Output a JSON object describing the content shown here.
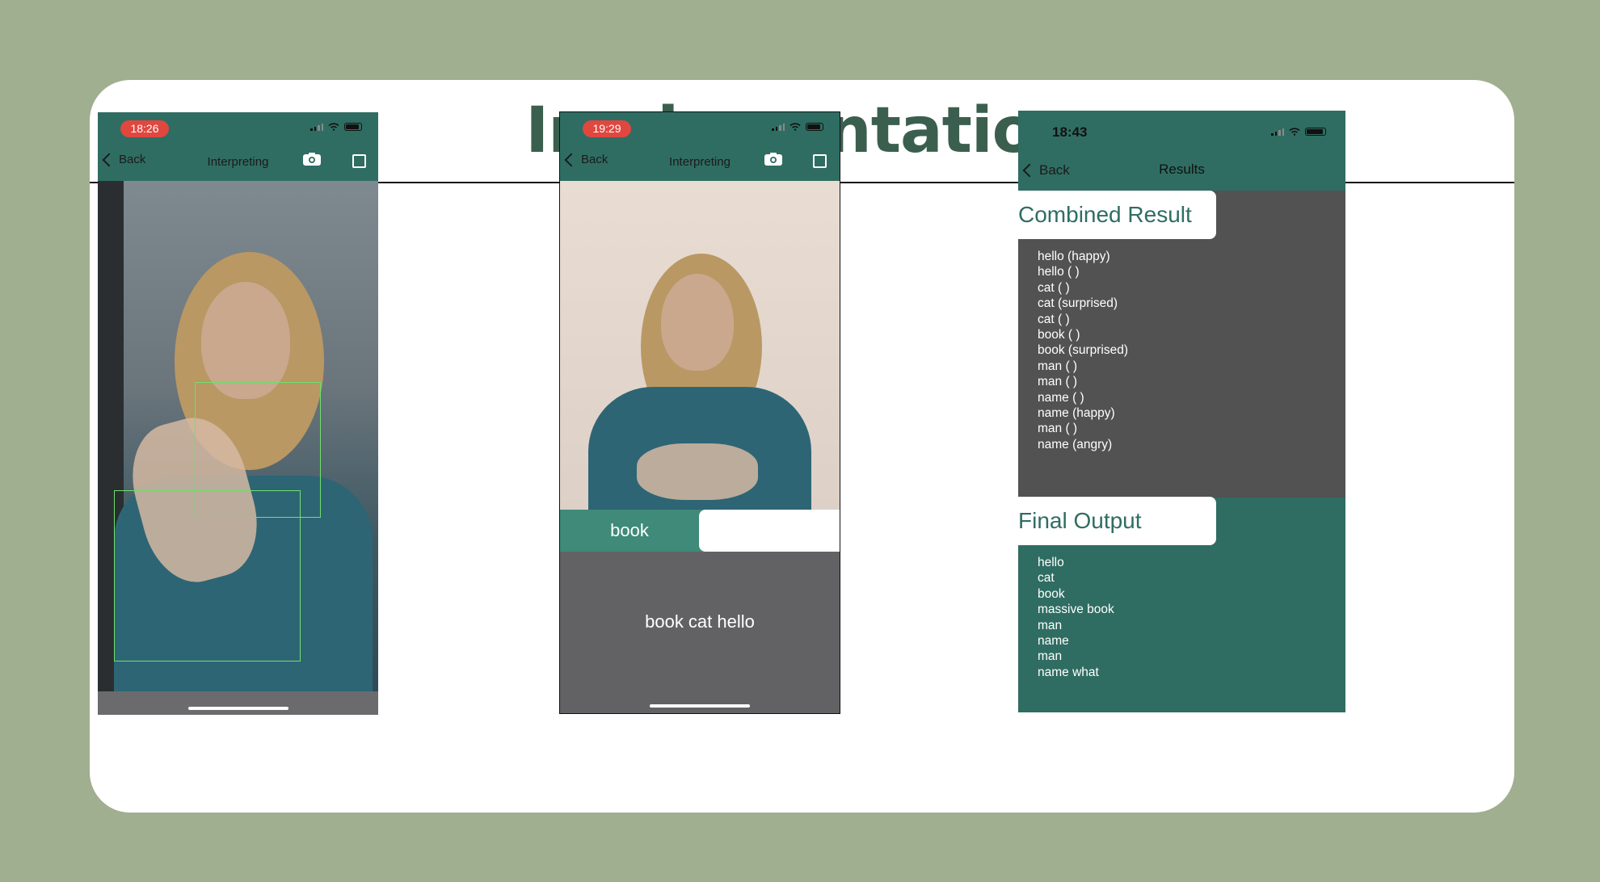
{
  "slide": {
    "title": "Implementation",
    "dot_colors": [
      "#000000",
      "#cfdd8f",
      "#dcdcdc"
    ],
    "accent_color": "#3b5f4e",
    "background_color": "#a0af8f"
  },
  "phone1": {
    "time": "18:26",
    "back_label": "Back",
    "nav_title": "Interpreting",
    "icons": [
      "camera-flip-icon",
      "square-icon"
    ]
  },
  "phone2": {
    "time": "19:29",
    "back_label": "Back",
    "nav_title": "Interpreting",
    "icons": [
      "camera-flip-icon",
      "square-icon"
    ],
    "current_sign": "book",
    "sentence": "book cat hello"
  },
  "phone3": {
    "time": "18:43",
    "back_label": "Back",
    "nav_title": "Results",
    "combined_heading": "Combined Result",
    "combined_items": [
      "hello (happy)",
      "hello ( )",
      "cat ( )",
      "cat (surprised)",
      "cat ( )",
      "book ( )",
      "book (surprised)",
      "man ( )",
      "man ( )",
      "name ( )",
      "name (happy)",
      "man ( )",
      "name (angry)"
    ],
    "final_heading": "Final Output",
    "final_items": [
      "hello",
      "cat",
      "book",
      "massive book",
      "man",
      "name",
      "man",
      "name what"
    ]
  }
}
